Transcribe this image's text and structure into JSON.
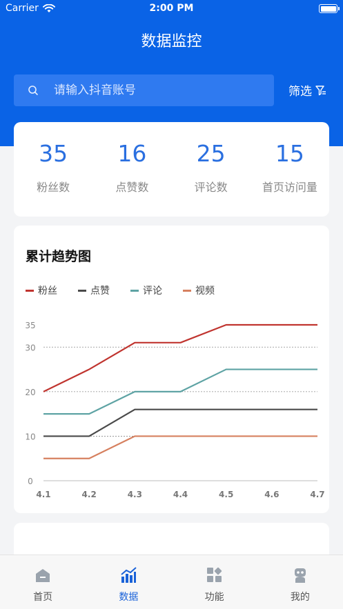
{
  "status_bar": {
    "carrier": "Carrier",
    "time": "2:00 PM"
  },
  "header": {
    "title": "数据监控"
  },
  "search": {
    "placeholder": "请输入抖音账号"
  },
  "filter": {
    "label": "筛选"
  },
  "stats": [
    {
      "value": "35",
      "label": "粉丝数"
    },
    {
      "value": "16",
      "label": "点赞数"
    },
    {
      "value": "25",
      "label": "评论数"
    },
    {
      "value": "15",
      "label": "首页访问量"
    }
  ],
  "chart_card": {
    "title": "累计趋势图"
  },
  "colors": {
    "primary": "#0a63e6",
    "accent": "#2a6fe0"
  },
  "chart_data": {
    "type": "line",
    "title": "累计趋势图",
    "x": [
      "4.1",
      "4.2",
      "4.3",
      "4.4",
      "4.5",
      "4.6",
      "4.7"
    ],
    "yticks": [
      0,
      10,
      20,
      30,
      35
    ],
    "ylim": [
      0,
      35
    ],
    "grid": "dotted at 10, 20, 30",
    "legend": "top-left",
    "series": [
      {
        "name": "粉丝",
        "color": "#c0342f",
        "values": [
          20,
          25,
          31,
          31,
          35,
          35,
          35
        ]
      },
      {
        "name": "点赞",
        "color": "#4a4a4a",
        "values": [
          10,
          10,
          16,
          16,
          16,
          16,
          16
        ]
      },
      {
        "name": "评论",
        "color": "#5ea3a4",
        "values": [
          15,
          15,
          20,
          20,
          25,
          25,
          25
        ]
      },
      {
        "name": "视频",
        "color": "#d6805f",
        "values": [
          5,
          5,
          10,
          10,
          10,
          10,
          10
        ]
      }
    ]
  },
  "tabbar": {
    "tabs": [
      {
        "label": "首页",
        "icon": "home-icon",
        "active": false
      },
      {
        "label": "数据",
        "icon": "chart-icon",
        "active": true
      },
      {
        "label": "功能",
        "icon": "grid-icon",
        "active": false
      },
      {
        "label": "我的",
        "icon": "robot-icon",
        "active": false
      }
    ]
  }
}
